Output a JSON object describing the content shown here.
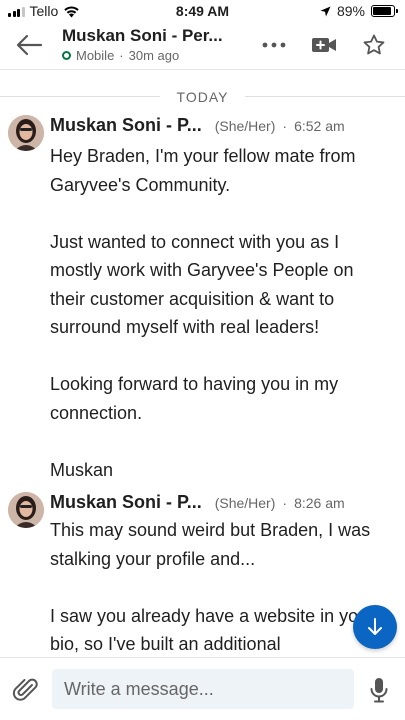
{
  "status_bar": {
    "carrier": "Tello",
    "time": "8:49 AM",
    "battery": "89%",
    "battery_level": 0.89
  },
  "header": {
    "title": "Muskan Soni - Per...",
    "presence": "Mobile",
    "last_seen": "30m ago"
  },
  "conversation": {
    "day_label": "TODAY",
    "messages": [
      {
        "sender": "Muskan Soni - P...",
        "pronouns": "(She/Her)",
        "time": "6:52 am",
        "paragraphs": [
          "Hey Braden, I'm your fellow mate from Garyvee's Community.",
          "Just wanted to connect with you as I mostly work with Garyvee's People on their customer acquisition & want to surround myself with real leaders!",
          "Looking forward to having you in my connection.",
          "Muskan"
        ]
      },
      {
        "sender": "Muskan Soni - P...",
        "pronouns": "(She/Her)",
        "time": "8:26 am",
        "paragraphs": [
          "This may sound weird but Braden, I was stalking your profile and...",
          "I saw you already have a website in your bio, so I've built an additional"
        ]
      }
    ]
  },
  "composer": {
    "placeholder": "Write a message..."
  },
  "colors": {
    "brand_blue": "#0a66c2",
    "online_green": "#057642",
    "compose_bg": "#eef3f8"
  }
}
